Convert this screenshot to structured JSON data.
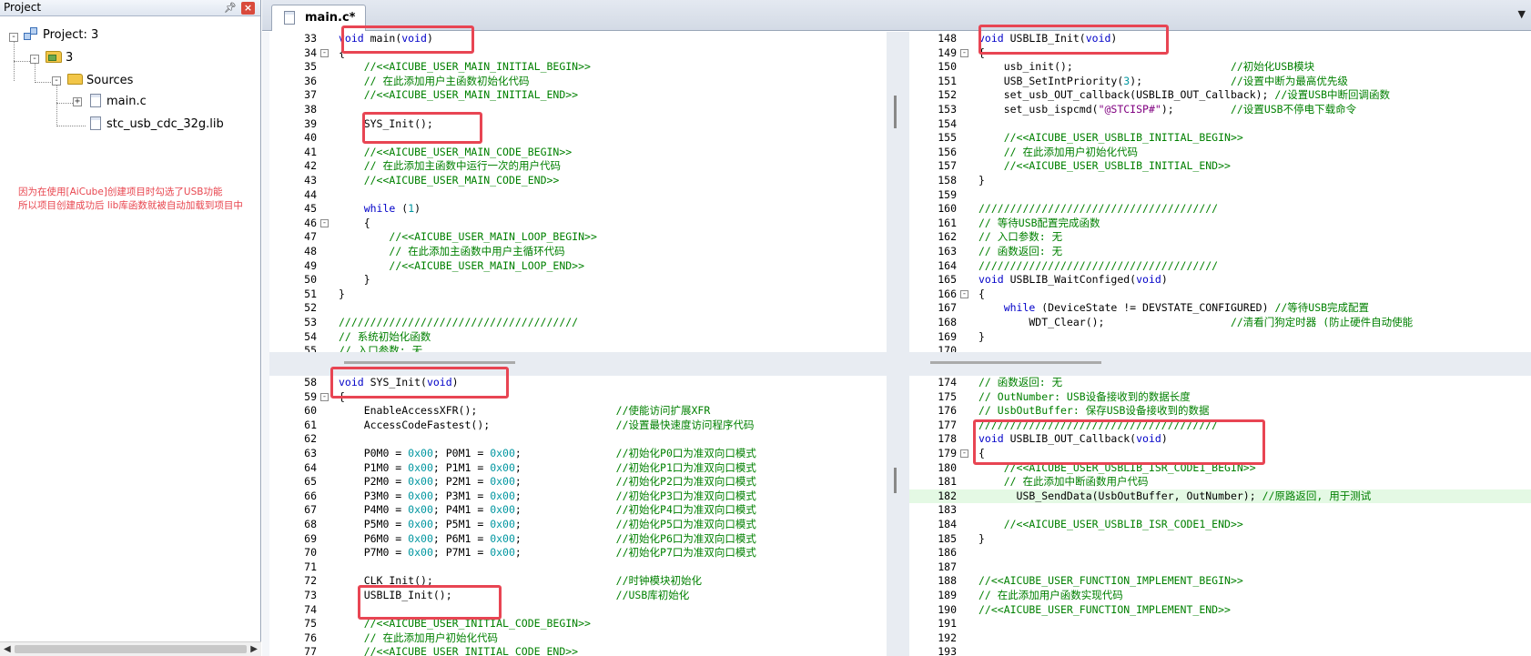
{
  "project_panel": {
    "title": "Project",
    "pin_icon": "pin-icon",
    "close_icon": "close-icon",
    "tree": {
      "project_label": "Project: 3",
      "target_label": "3",
      "group_label": "Sources",
      "files": [
        "main.c",
        "stc_usb_cdc_32g.lib"
      ]
    },
    "annotation": [
      "因为在使用[AiCube]创建项目时勾选了USB功能",
      "所以项目创建成功后 lib库函数就被自动加载到项目中"
    ]
  },
  "editor": {
    "tab_label": "main.c*",
    "panes": {
      "top_left": [
        {
          "n": "33",
          "t": "void main(void)"
        },
        {
          "n": "34",
          "fold": "-",
          "t": "{"
        },
        {
          "n": "35",
          "t": "    //<<AICUBE_USER_MAIN_INITIAL_BEGIN>>"
        },
        {
          "n": "36",
          "t": "    // 在此添加用户主函数初始化代码"
        },
        {
          "n": "37",
          "t": "    //<<AICUBE_USER_MAIN_INITIAL_END>>"
        },
        {
          "n": "38",
          "t": ""
        },
        {
          "n": "39",
          "t": "    SYS_Init();"
        },
        {
          "n": "40",
          "t": ""
        },
        {
          "n": "41",
          "t": "    //<<AICUBE_USER_MAIN_CODE_BEGIN>>"
        },
        {
          "n": "42",
          "t": "    // 在此添加主函数中运行一次的用户代码"
        },
        {
          "n": "43",
          "t": "    //<<AICUBE_USER_MAIN_CODE_END>>"
        },
        {
          "n": "44",
          "t": ""
        },
        {
          "n": "45",
          "t": "    while (1)"
        },
        {
          "n": "46",
          "fold": "-",
          "t": "    {"
        },
        {
          "n": "47",
          "t": "        //<<AICUBE_USER_MAIN_LOOP_BEGIN>>"
        },
        {
          "n": "48",
          "t": "        // 在此添加主函数中用户主循环代码"
        },
        {
          "n": "49",
          "t": "        //<<AICUBE_USER_MAIN_LOOP_END>>"
        },
        {
          "n": "50",
          "t": "    }"
        },
        {
          "n": "51",
          "t": "}"
        },
        {
          "n": "52",
          "t": ""
        },
        {
          "n": "53",
          "t": "//////////////////////////////////////"
        },
        {
          "n": "54",
          "t": "// 系统初始化函数"
        },
        {
          "n": "55",
          "t": "// 入口参数: 无"
        }
      ],
      "top_right": [
        {
          "n": "148",
          "t": "void USBLIB_Init(void)"
        },
        {
          "n": "149",
          "fold": "-",
          "t": "{"
        },
        {
          "n": "150",
          "t": "    usb_init();                         //初始化USB模块"
        },
        {
          "n": "151",
          "t": "    USB_SetIntPriority(3);              //设置中断为最高优先级"
        },
        {
          "n": "152",
          "t": "    set_usb_OUT_callback(USBLIB_OUT_Callback); //设置USB中断回调函数"
        },
        {
          "n": "153",
          "t": "    set_usb_ispcmd(\"@STCISP#\");         //设置USB不停电下载命令"
        },
        {
          "n": "154",
          "t": ""
        },
        {
          "n": "155",
          "t": "    //<<AICUBE_USER_USBLIB_INITIAL_BEGIN>>"
        },
        {
          "n": "156",
          "t": "    // 在此添加用户初始化代码"
        },
        {
          "n": "157",
          "t": "    //<<AICUBE_USER_USBLIB_INITIAL_END>>"
        },
        {
          "n": "158",
          "t": "}"
        },
        {
          "n": "159",
          "t": ""
        },
        {
          "n": "160",
          "t": "//////////////////////////////////////"
        },
        {
          "n": "161",
          "t": "// 等待USB配置完成函数"
        },
        {
          "n": "162",
          "t": "// 入口参数: 无"
        },
        {
          "n": "163",
          "t": "// 函数返回: 无"
        },
        {
          "n": "164",
          "t": "//////////////////////////////////////"
        },
        {
          "n": "165",
          "t": "void USBLIB_WaitConfiged(void)"
        },
        {
          "n": "166",
          "fold": "-",
          "t": "{"
        },
        {
          "n": "167",
          "t": "    while (DeviceState != DEVSTATE_CONFIGURED) //等待USB完成配置"
        },
        {
          "n": "168",
          "t": "        WDT_Clear();                    //清看门狗定时器 (防止硬件自动使能"
        },
        {
          "n": "169",
          "t": "}"
        },
        {
          "n": "170",
          "t": ""
        }
      ],
      "bottom_left": [
        {
          "n": "58",
          "t": "void SYS_Init(void)"
        },
        {
          "n": "59",
          "fold": "-",
          "t": "{"
        },
        {
          "n": "60",
          "t": "    EnableAccessXFR();                      //使能访问扩展XFR"
        },
        {
          "n": "61",
          "t": "    AccessCodeFastest();                    //设置最快速度访问程序代码"
        },
        {
          "n": "62",
          "t": ""
        },
        {
          "n": "63",
          "t": "    P0M0 = 0x00; P0M1 = 0x00;               //初始化P0口为准双向口模式"
        },
        {
          "n": "64",
          "t": "    P1M0 = 0x00; P1M1 = 0x00;               //初始化P1口为准双向口模式"
        },
        {
          "n": "65",
          "t": "    P2M0 = 0x00; P2M1 = 0x00;               //初始化P2口为准双向口模式"
        },
        {
          "n": "66",
          "t": "    P3M0 = 0x00; P3M1 = 0x00;               //初始化P3口为准双向口模式"
        },
        {
          "n": "67",
          "t": "    P4M0 = 0x00; P4M1 = 0x00;               //初始化P4口为准双向口模式"
        },
        {
          "n": "68",
          "t": "    P5M0 = 0x00; P5M1 = 0x00;               //初始化P5口为准双向口模式"
        },
        {
          "n": "69",
          "t": "    P6M0 = 0x00; P6M1 = 0x00;               //初始化P6口为准双向口模式"
        },
        {
          "n": "70",
          "t": "    P7M0 = 0x00; P7M1 = 0x00;               //初始化P7口为准双向口模式"
        },
        {
          "n": "71",
          "t": ""
        },
        {
          "n": "72",
          "t": "    CLK_Init();                             //时钟模块初始化"
        },
        {
          "n": "73",
          "t": "    USBLIB_Init();                          //USB库初始化"
        },
        {
          "n": "74",
          "t": ""
        },
        {
          "n": "75",
          "t": "    //<<AICUBE_USER_INITIAL_CODE_BEGIN>>"
        },
        {
          "n": "76",
          "t": "    // 在此添加用户初始化代码"
        },
        {
          "n": "77",
          "t": "    //<<AICUBE_USER_INITIAL_CODE_END>>"
        }
      ],
      "bottom_right": [
        {
          "n": "174",
          "t": "// 函数返回: 无"
        },
        {
          "n": "175",
          "t": "// OutNumber: USB设备接收到的数据长度"
        },
        {
          "n": "176",
          "t": "// UsbOutBuffer: 保存USB设备接收到的数据"
        },
        {
          "n": "177",
          "t": "//////////////////////////////////////"
        },
        {
          "n": "178",
          "t": "void USBLIB_OUT_Callback(void)"
        },
        {
          "n": "179",
          "fold": "-",
          "t": "{"
        },
        {
          "n": "180",
          "t": "    //<<AICUBE_USER_USBLIB_ISR_CODE1_BEGIN>>"
        },
        {
          "n": "181",
          "t": "    // 在此添加中断函数用户代码"
        },
        {
          "n": "182",
          "hl": true,
          "t": "      USB_SendData(UsbOutBuffer, OutNumber); //原路返回, 用于测试"
        },
        {
          "n": "183",
          "t": ""
        },
        {
          "n": "184",
          "t": "    //<<AICUBE_USER_USBLIB_ISR_CODE1_END>>"
        },
        {
          "n": "185",
          "t": "}"
        },
        {
          "n": "186",
          "t": ""
        },
        {
          "n": "187",
          "t": ""
        },
        {
          "n": "188",
          "t": "//<<AICUBE_USER_FUNCTION_IMPLEMENT_BEGIN>>"
        },
        {
          "n": "189",
          "t": "// 在此添加用户函数实现代码"
        },
        {
          "n": "190",
          "t": "//<<AICUBE_USER_FUNCTION_IMPLEMENT_END>>"
        },
        {
          "n": "191",
          "t": ""
        },
        {
          "n": "192",
          "t": ""
        },
        {
          "n": "193",
          "t": ""
        }
      ]
    }
  },
  "colors": {
    "keyword": "#0000c8",
    "comment": "#008000",
    "number": "#0096a0",
    "string": "#800080",
    "highlight_box": "#e84553",
    "annotation": "#e8464f"
  }
}
